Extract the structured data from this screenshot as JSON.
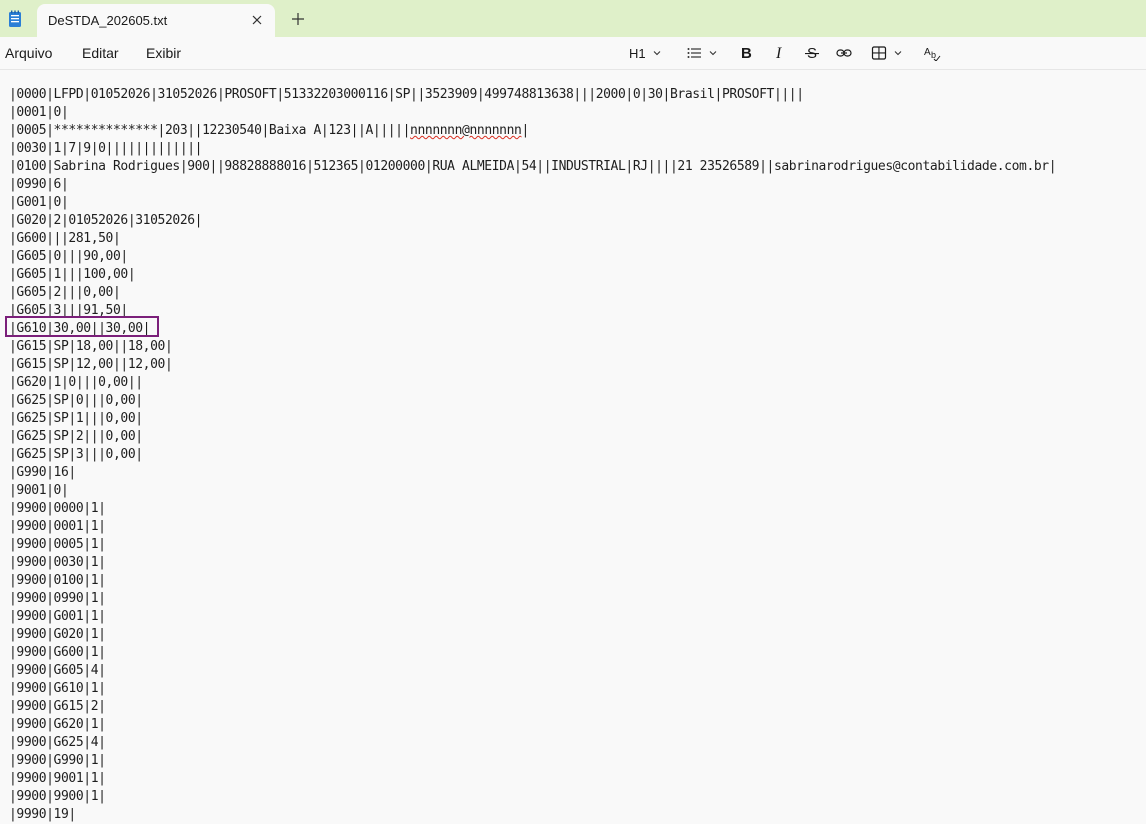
{
  "app": {
    "icon": "notepad-icon",
    "tab_title": "DeSTDA_202605.txt"
  },
  "menu": {
    "file": "Arquivo",
    "edit": "Editar",
    "view": "Exibir"
  },
  "toolbar": {
    "heading_label": "H1",
    "list_icon": "bulleted-list-icon",
    "bold_icon": "bold-icon",
    "italic_icon": "italic-icon",
    "strike_icon": "strikethrough-icon",
    "link_icon": "link-icon",
    "table_icon": "table-icon",
    "spellcheck_icon": "spellcheck-icon"
  },
  "document": {
    "lines": [
      "|0000|LFPD|01052026|31052026|PROSOFT|51332203000116|SP||3523909|499748813638|||2000|0|30|Brasil|PROSOFT||||",
      "|0001|0|",
      "|0005|**************|203||12230540|Baixa A|123||A|||||nnnnnnn@nnnnnnn|",
      "|0030|1|7|9|0|||||||||||||",
      "|0100|Sabrina Rodrigues|900||98828888016|512365|01200000|RUA ALMEIDA|54||INDUSTRIAL|RJ||||21 23526589||sabrinarodrigues@contabilidade.com.br|",
      "|0990|6|",
      "|G001|0|",
      "|G020|2|01052026|31052026|",
      "|G600|||281,50|",
      "|G605|0|||90,00|",
      "|G605|1|||100,00|",
      "|G605|2|||0,00|",
      "|G605|3|||91,50|",
      "|G610|30,00||30,00|",
      "|G615|SP|18,00||18,00|",
      "|G615|SP|12,00||12,00|",
      "|G620|1|0|||0,00||",
      "|G625|SP|0|||0,00|",
      "|G625|SP|1|||0,00|",
      "|G625|SP|2|||0,00|",
      "|G625|SP|3|||0,00|",
      "|G990|16|",
      "|9001|0|",
      "|9900|0000|1|",
      "|9900|0001|1|",
      "|9900|0005|1|",
      "|9900|0030|1|",
      "|9900|0100|1|",
      "|9900|0990|1|",
      "|9900|G001|1|",
      "|9900|G020|1|",
      "|9900|G600|1|",
      "|9900|G605|4|",
      "|9900|G610|1|",
      "|9900|G615|2|",
      "|9900|G620|1|",
      "|9900|G625|4|",
      "|9900|G990|1|",
      "|9900|9001|1|",
      "|9900|9900|1|",
      "|9990|19|"
    ],
    "line_0005_prefix": "|0005|**************|203||12230540|Baixa A|123||A|||||",
    "line_0005_misspelled": "nnnnnnn@nnnnnnn",
    "line_0005_suffix": "|"
  },
  "colors": {
    "tabbar_bg": "#dff0c9",
    "editor_bg": "#f9f9f9",
    "highlight_border": "#7b1f7a",
    "spell_underline": "#d92d20"
  }
}
